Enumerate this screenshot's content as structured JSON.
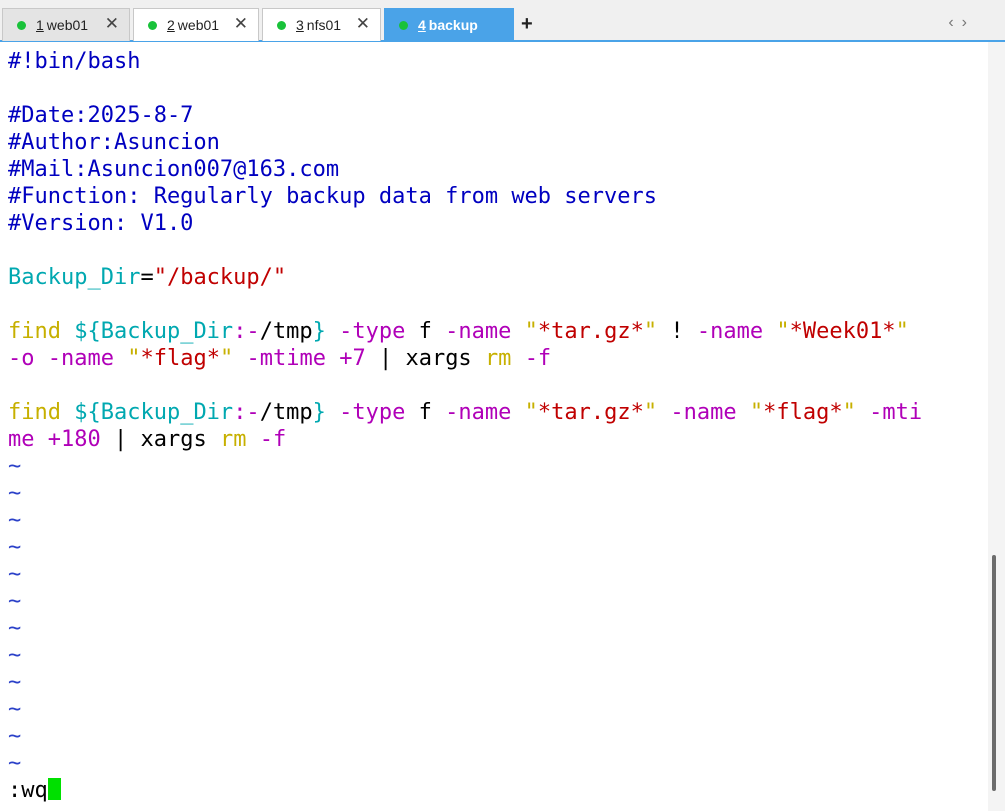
{
  "tabs": [
    {
      "num": "1",
      "label": "web01",
      "active": false
    },
    {
      "num": "2",
      "label": "web01",
      "active": false
    },
    {
      "num": "3",
      "label": "nfs01",
      "active": false
    },
    {
      "num": "4",
      "label": "backup",
      "active": true
    }
  ],
  "tab_close_glyph": "✕",
  "new_tab_glyph": "+",
  "nav": {
    "prev": "‹",
    "next": "›"
  },
  "editor": {
    "shebang": "#!bin/bash",
    "date": "#Date:2025-8-7",
    "author": "#Author:Asuncion",
    "mail": "#Mail:Asuncion007@163.com",
    "function": "#Function: Regularly backup data from web servers",
    "version": "#Version: V1.0",
    "assign": {
      "name": "Backup_Dir",
      "eq": "=",
      "value": "\"/backup/\""
    },
    "cmd1": {
      "find": "find",
      "var_open": "${Backup_Dir",
      "var_default_op": ":-",
      "var_default": "/tmp",
      "var_close": "}",
      "type_opt": "-type",
      "type_val": "f",
      "name_opt": "-name",
      "q1": "\"",
      "pattern1": "*tar.gz*",
      "bang": "!",
      "pattern2": "*Week01*",
      "or_opt": "-o",
      "pattern3": "*flag*",
      "mtime_opt": "-mtime",
      "mtime_val": "+7",
      "pipe": "|",
      "xargs": "xargs",
      "rm": "rm",
      "rm_opt": "-f"
    },
    "cmd2": {
      "find": "find",
      "var_open": "${Backup_Dir",
      "var_default_op": ":-",
      "var_default": "/tmp",
      "var_close": "}",
      "type_opt": "-type",
      "type_val": "f",
      "name_opt": "-name",
      "pattern1": "*tar.gz*",
      "pattern2": "*flag*",
      "mtime_opt_a": "-mti",
      "mtime_opt_b": "me",
      "mtime_val": "+180",
      "pipe": "|",
      "xargs": "xargs",
      "rm": "rm",
      "rm_opt": "-f"
    },
    "tilde": "~",
    "command_line": ":wq"
  },
  "colors": {
    "comment": "#0000c0",
    "variable": "#00a8b0",
    "string": "#c00000",
    "keyword": "#c7b000",
    "option": "#b000b8",
    "cursor": "#00e000",
    "active_tab": "#4aa3e8",
    "status_dot": "#19c23a"
  }
}
